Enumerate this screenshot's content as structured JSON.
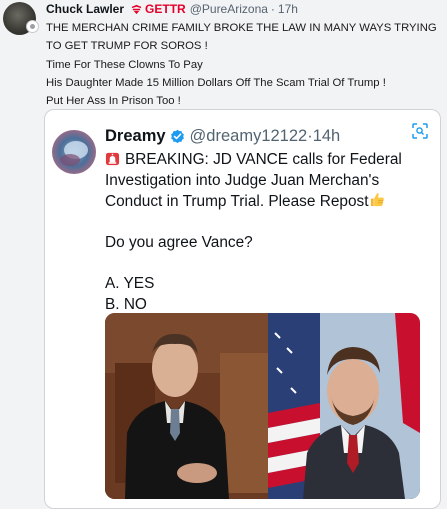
{
  "post": {
    "author": "Chuck Lawler",
    "network": "GETTR",
    "handle": "@PureArizona",
    "separator": "·",
    "time": "17h",
    "lines": [
      "THE MERCHAN CRIME FAMILY BROKE THE LAW IN MANY WAYS TRYING",
      "TO GET TRUMP FOR SOROS !",
      "Time For These Clowns To Pay",
      "His Daughter Made 15 Million Dollars Off The Scam Trial Of Trump !",
      "Put Her Ass In Prison Too !"
    ]
  },
  "quoted": {
    "name": "Dreamy",
    "handle": "@dreamy12122",
    "separator": "·",
    "time": "14h",
    "lines": [
      "BREAKING: JD VANCE calls for Federal",
      "Investigation into Judge Juan Merchan's",
      "Conduct in Trump Trial. Please Repost",
      "",
      "Do you agree Vance?",
      "",
      "A. YES",
      "B. NO"
    ]
  },
  "icons": {
    "network_logo": "gettr-logo-icon",
    "verified": "verified-badge-icon",
    "siren": "siren-emoji-icon",
    "thumb": "thumbs-up-emoji-icon",
    "scan": "scan-icon"
  },
  "colors": {
    "gettr_red": "#e4002b",
    "verified_blue": "#1d9bf0",
    "muted_text": "#536471"
  }
}
